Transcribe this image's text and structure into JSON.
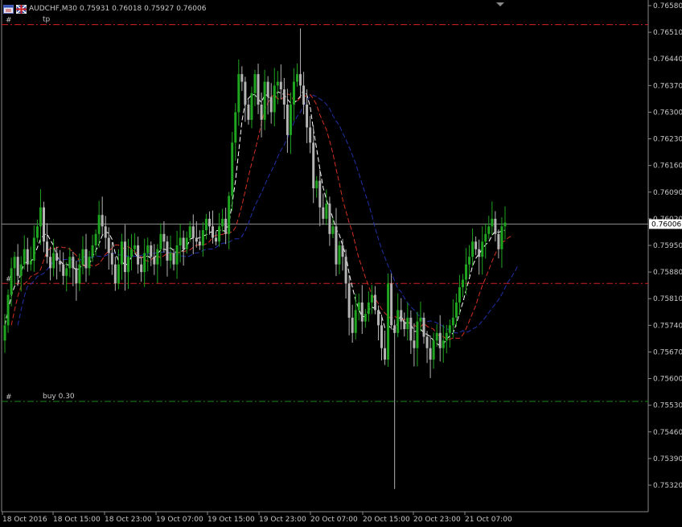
{
  "header": {
    "symbol_timeframe": "AUDCHF,M30",
    "ohlc": "0.75931 0.76018 0.75927 0.76006"
  },
  "colors": {
    "background": "#000000",
    "grid_line": "#8a8a8a",
    "bull_candle": "#1fa51f",
    "bear_candle": "#b4b4b4",
    "ma_fast": "#ffffff",
    "ma_mid": "#d43020",
    "ma_slow": "#2030a8",
    "tp_line": "#d42020",
    "buy_line": "#1b8a1b",
    "entry_line": "#d42020"
  },
  "chart_data": {
    "type": "candlestick",
    "symbol": "AUDCHF",
    "timeframe": "M30",
    "price_range": [
      0.7526,
      0.7659
    ],
    "price_ticks": [
      "0.76580",
      "0.76510",
      "0.76440",
      "0.76370",
      "0.76300",
      "0.76230",
      "0.76160",
      "0.76090",
      "0.76020",
      "0.75950",
      "0.75880",
      "0.75810",
      "0.75740",
      "0.75670",
      "0.75600",
      "0.75530",
      "0.75460",
      "0.75390",
      "0.75320"
    ],
    "time_labels": [
      "18 Oct 2016",
      "18 Oct 15:00",
      "18 Oct 23:00",
      "19 Oct 07:00",
      "19 Oct 15:00",
      "19 Oct 23:00",
      "20 Oct 07:00",
      "20 Oct 15:00",
      "20 Oct 23:00",
      "21 Oct 07:00"
    ],
    "current_price": "0.76006",
    "levels": [
      {
        "name": "tp",
        "price": 0.7653,
        "label": "tp"
      },
      {
        "name": "entry",
        "price": 0.7585,
        "label": ""
      },
      {
        "name": "buy",
        "price": 0.7554,
        "label": "buy 0.30"
      }
    ],
    "close": [
      0.7574,
      0.7582,
      0.7589,
      0.7592,
      0.7587,
      0.759,
      0.7594,
      0.759,
      0.7591,
      0.7597,
      0.76,
      0.7605,
      0.7596,
      0.7592,
      0.7589,
      0.7593,
      0.7591,
      0.759,
      0.7587,
      0.7589,
      0.7592,
      0.7589,
      0.7585,
      0.759,
      0.7594,
      0.7589,
      0.7592,
      0.7595,
      0.7598,
      0.7603,
      0.76,
      0.7597,
      0.7593,
      0.759,
      0.7585,
      0.759,
      0.7596,
      0.7588,
      0.7592,
      0.7594,
      0.7595,
      0.759,
      0.7588,
      0.7593,
      0.7595,
      0.7592,
      0.759,
      0.7594,
      0.7598,
      0.7596,
      0.7591,
      0.7593,
      0.759,
      0.7595,
      0.7597,
      0.7594,
      0.7597,
      0.76,
      0.7597,
      0.7596,
      0.7595,
      0.7599,
      0.7602,
      0.76,
      0.7597,
      0.7596,
      0.76,
      0.7602,
      0.7598,
      0.7608,
      0.7622,
      0.763,
      0.764,
      0.7638,
      0.7632,
      0.7628,
      0.7635,
      0.764,
      0.7632,
      0.7628,
      0.7638,
      0.7634,
      0.763,
      0.7637,
      0.7638,
      0.7636,
      0.7632,
      0.7624,
      0.7632,
      0.7638,
      0.764,
      0.7637,
      0.7632,
      0.7626,
      0.7622,
      0.761,
      0.7612,
      0.7605,
      0.7602,
      0.7606,
      0.7598,
      0.76,
      0.759,
      0.7595,
      0.7592,
      0.7585,
      0.7576,
      0.7572,
      0.7578,
      0.758,
      0.7575,
      0.7577,
      0.758,
      0.7582,
      0.7578,
      0.7574,
      0.7568,
      0.7565,
      0.7585,
      0.7574,
      0.7572,
      0.7578,
      0.7575,
      0.7573,
      0.7576,
      0.757,
      0.7568,
      0.7575,
      0.7576,
      0.7571,
      0.7568,
      0.7565,
      0.757,
      0.7572,
      0.7568,
      0.757,
      0.7572,
      0.7574,
      0.7576,
      0.758,
      0.7584,
      0.7586,
      0.759,
      0.7592,
      0.7596,
      0.7594,
      0.7592,
      0.7596,
      0.7598,
      0.76,
      0.7602,
      0.7598,
      0.7594,
      0.76,
      0.7601
    ]
  }
}
